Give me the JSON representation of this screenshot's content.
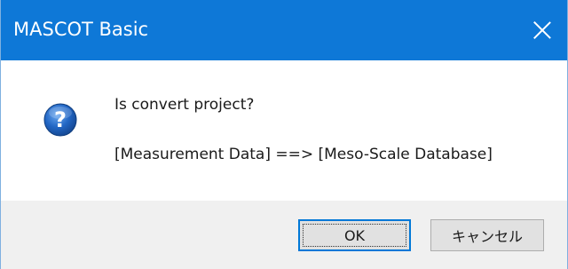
{
  "window": {
    "title": "MASCOT Basic",
    "titlebar_color": "#0e78d7",
    "close_icon": "close-icon"
  },
  "message": {
    "icon": "question-icon",
    "line1": "Is convert project?",
    "line2": "[Measurement Data] ==> [Meso-Scale Database]"
  },
  "buttons": {
    "ok_label": "OK",
    "cancel_label": "キャンセル"
  }
}
